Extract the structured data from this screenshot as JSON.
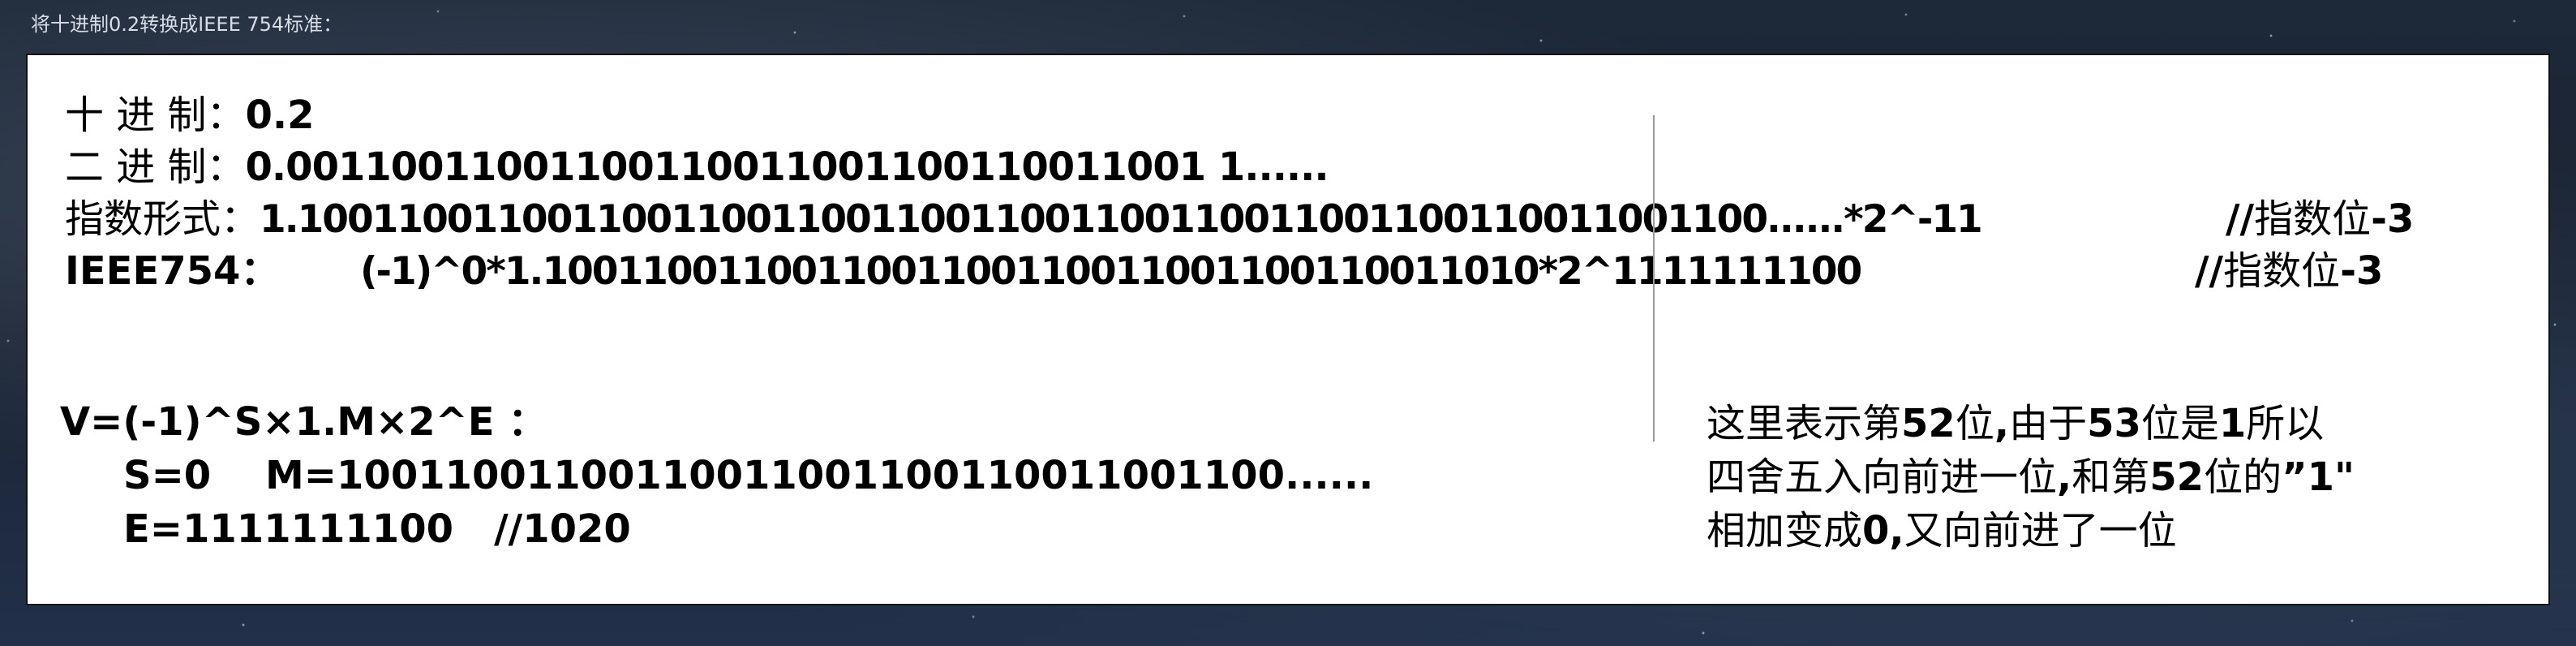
{
  "window": {
    "title": "将十进制0.2转换成IEEE 754标准："
  },
  "rows": {
    "decimal": {
      "label": "十 进 制：",
      "value": "0.2"
    },
    "binary": {
      "label": "二 进 制：",
      "value": "0.00110011001100110011001100110011001 1......"
    },
    "exponent": {
      "label": "指数形式：",
      "value": "1.10011001100110011001100110011001100110011001100110011001100......*2^-11",
      "comment_slash": "//",
      "comment_text": "指数位",
      "comment_num": "-3"
    },
    "ieee": {
      "label": "IEEE754：",
      "value": "(-1)^0*1.1001100110011001100110011001100110011010*2^1111111100",
      "comment_slash": "//",
      "comment_text": "指数位",
      "comment_num": "-3"
    }
  },
  "formula": {
    "line1": "V=(-1)^S×1.M×2^E ：",
    "line2": "S=0    M=10011001100110011001100110011001100......",
    "line3": "E=1111111100   //1020"
  },
  "note": {
    "line1_a": "这里表示第",
    "line1_b": "52",
    "line1_c": "位",
    "line1_d": ",",
    "line1_e": "由于",
    "line1_f": "53",
    "line1_g": "位是",
    "line1_h": "1",
    "line1_i": "所以",
    "line2_a": "四舍五入向前进一位",
    "line2_b": ",",
    "line2_c": "和第",
    "line2_d": "52",
    "line2_e": "位的",
    "line2_f": "”1\"",
    "line3_a": "相加变成",
    "line3_b": "0",
    "line3_c": ",",
    "line3_d": "又向前进了一位"
  }
}
